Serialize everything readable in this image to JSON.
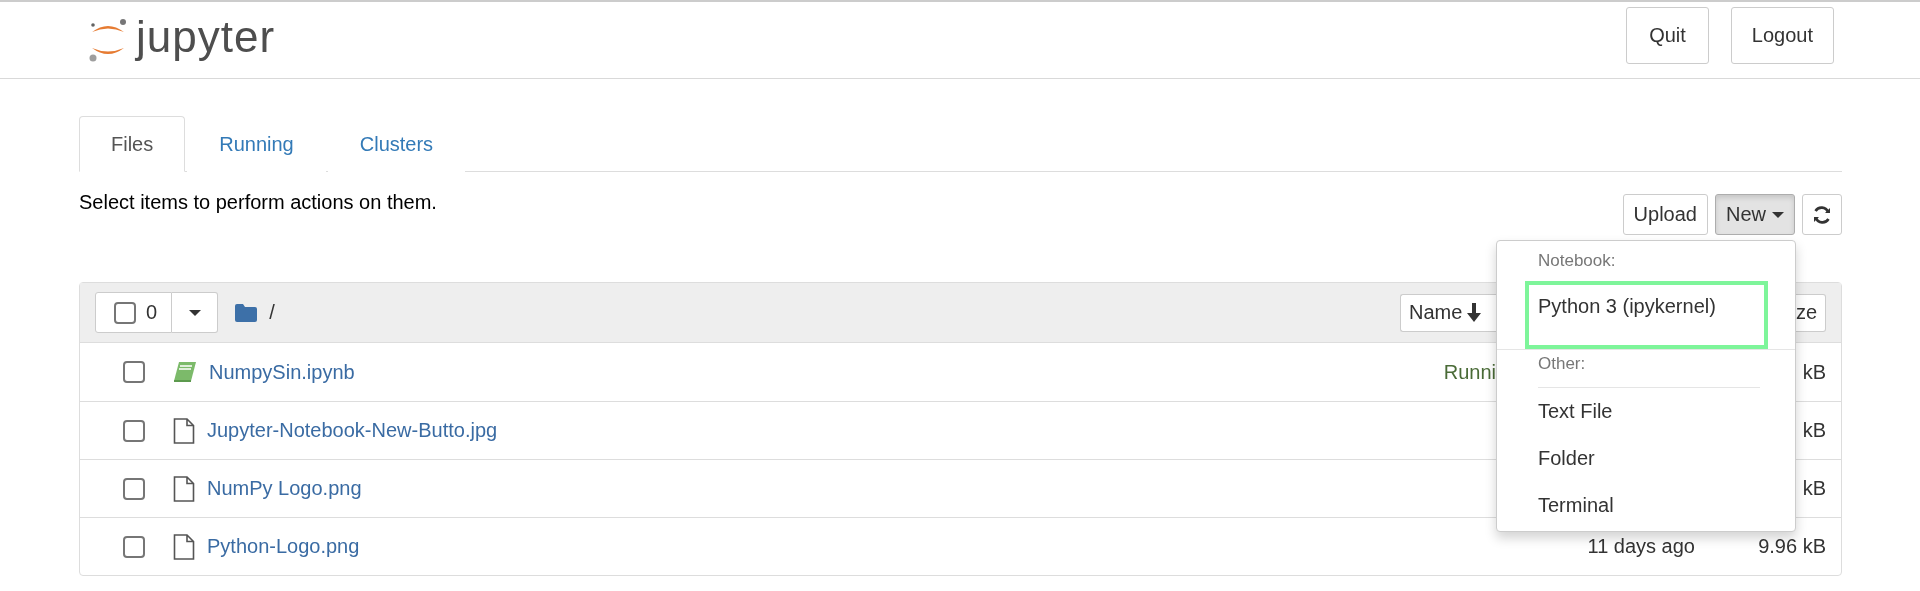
{
  "header": {
    "logo_text": "jupyter",
    "buttons": [
      "Quit",
      "Logout"
    ]
  },
  "tabs": [
    {
      "label": "Files",
      "selected": true
    },
    {
      "label": "Running",
      "selected": false
    },
    {
      "label": "Clusters",
      "selected": false
    }
  ],
  "toolbar": {
    "hint": "Select items to perform actions on them.",
    "buttons": [
      {
        "label": "Upload",
        "active": false
      },
      {
        "label": "New",
        "active": true
      }
    ]
  },
  "list_header": {
    "selected_count": "0",
    "checked": false,
    "path": "/",
    "sort_button": "Name",
    "size_button": "ze"
  },
  "rows": [
    {
      "kind": "notebook",
      "name": "NumpySin.ipynb",
      "checked": false,
      "status": "Runni",
      "size": "kB"
    },
    {
      "kind": "file",
      "name": "Jupyter-Notebook-New-Butto.jpg",
      "checked": false,
      "size": "kB"
    },
    {
      "kind": "file",
      "name": "NumPy Logo.png",
      "checked": false,
      "size": "kB"
    },
    {
      "kind": "file",
      "name": "Python-Logo.png",
      "checked": false,
      "modified": "11 days ago",
      "size": "9.96 kB"
    }
  ],
  "new_menu": {
    "sections": [
      {
        "header": "Notebook:",
        "items": [
          {
            "label": "Python 3 (ipykernel)",
            "highlighted": true
          }
        ]
      },
      {
        "header": "Other:",
        "items": [
          {
            "label": "Text File",
            "highlighted": false
          },
          {
            "label": "Folder",
            "highlighted": false
          },
          {
            "label": "Terminal",
            "highlighted": false
          }
        ]
      }
    ]
  }
}
